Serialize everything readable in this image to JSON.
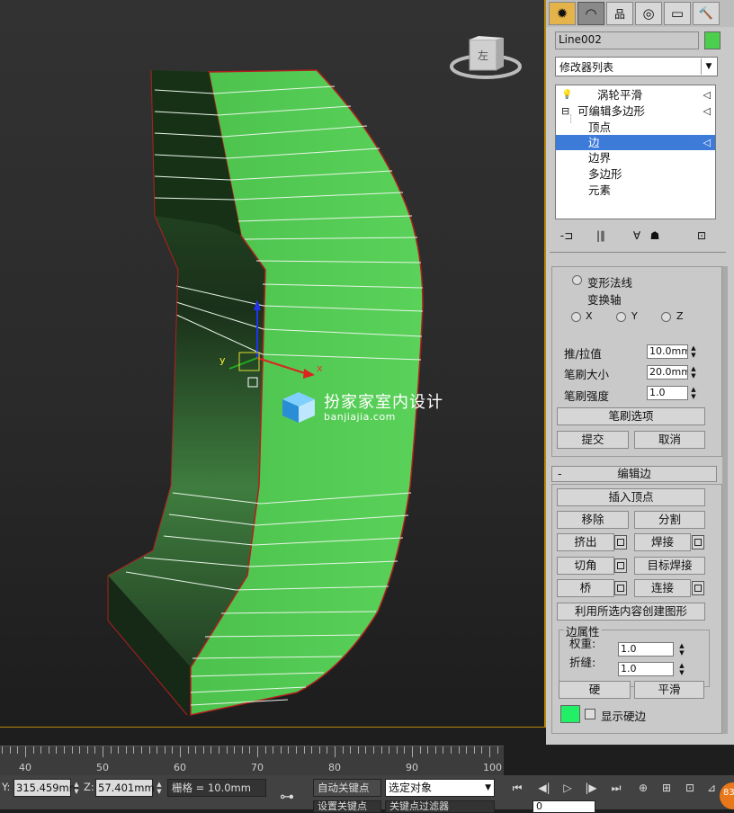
{
  "viewport": {
    "watermark_title": "扮家家室内设计",
    "watermark_sub": "banjiajia.com",
    "gizmo_x_label": "x",
    "gizmo_y_label": "y",
    "cube_label": "左"
  },
  "panel": {
    "tabs": [
      {
        "icon": "✹",
        "name": "create"
      },
      {
        "icon": "◠",
        "name": "modify"
      },
      {
        "icon": "品",
        "name": "hierarchy"
      },
      {
        "icon": "◎",
        "name": "motion"
      },
      {
        "icon": "▭",
        "name": "display"
      },
      {
        "icon": "🔨",
        "name": "utilities"
      }
    ],
    "object_name": "Line002",
    "object_color": "#4ccf4c",
    "modifier_list": "修改器列表",
    "stack": [
      {
        "label": "涡轮平滑",
        "prefix": "💡",
        "selected": false
      },
      {
        "label": "可编辑多边形",
        "prefix": "⊟",
        "selected": false
      },
      {
        "label": "顶点",
        "prefix": "",
        "selected": false
      },
      {
        "label": "边",
        "prefix": "",
        "selected": true
      },
      {
        "label": "边界",
        "prefix": "",
        "selected": false
      },
      {
        "label": "多边形",
        "prefix": "",
        "selected": false
      },
      {
        "label": "元素",
        "prefix": "",
        "selected": false
      }
    ],
    "stack_tools": [
      "-⊐",
      "|∥",
      "∀",
      "☗",
      "⊡"
    ],
    "deform": {
      "normal": "变形法线",
      "axis": "变换轴",
      "x": "X",
      "y": "Y",
      "z": "Z",
      "push_pull_label": "推/拉值",
      "push_pull_value": "10.0mm",
      "brush_size_label": "笔刷大小",
      "brush_size_value": "20.0mm",
      "brush_strength_label": "笔刷强度",
      "brush_strength_value": "1.0",
      "brush_options": "笔刷选项",
      "commit": "提交",
      "cancel": "取消"
    },
    "edit_edges": {
      "collapse_sign": "-",
      "title": "编辑边",
      "insert_vertex": "插入顶点",
      "remove": "移除",
      "split": "分割",
      "extrude": "挤出",
      "weld": "焊接",
      "chamfer": "切角",
      "target_weld": "目标焊接",
      "bridge": "桥",
      "connect": "连接",
      "create_shape": "利用所选内容创建图形",
      "edge_props": "边属性",
      "weight_label": "权重:",
      "weight_value": "1.0",
      "crease_label": "折缝:",
      "crease_value": "1.0",
      "hard": "硬",
      "smooth": "平滑",
      "show_hard": "显示硬边",
      "swatch_color": "#22ee66"
    }
  },
  "ruler": {
    "labels": [
      "40",
      "50",
      "60",
      "70",
      "80",
      "90",
      "100"
    ]
  },
  "status": {
    "y_label": "Y:",
    "y_value": "315.459mm",
    "z_label": "Z:",
    "z_value": "57.401mm",
    "grid": "栅格 = 10.0mm",
    "auto_key": "自动关键点",
    "selection": "选定对象",
    "set_key": "设置关键点",
    "key_filter": "关键点过滤器",
    "frame": "0",
    "corner_badge": "83"
  }
}
